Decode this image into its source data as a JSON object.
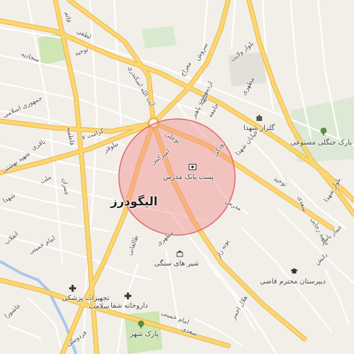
{
  "map": {
    "city_label": "الیگودرز",
    "colors": {
      "background": "#f2efe9",
      "primary_road": "#fcd670",
      "primary_road_casing": "#e8b84a",
      "minor_road": "#ffffff",
      "park": "#cde6b3",
      "water": "#a7c8e8",
      "highlight_circle_fill": "#f28b8b",
      "highlight_circle_stroke": "#e06666"
    },
    "highlight": {
      "label": "پست بانک مدرس",
      "icon": "bank-icon"
    },
    "pois": [
      {
        "label": "گلزار شهدا",
        "icon": "cemetery-icon"
      },
      {
        "label": "پارک جنگلی مصنوعی",
        "icon": "tree-icon"
      },
      {
        "label": "شیر های سنگی",
        "icon": "monument-icon"
      },
      {
        "label": "دبیرستان محترم قاضی",
        "icon": "school-icon"
      },
      {
        "label": "تجهیزات پزشکی سلامت",
        "icon": "pharmacy-icon"
      },
      {
        "label": "داروخانه شفا",
        "icon": "pharmacy-icon"
      },
      {
        "label": "پارک شهر",
        "icon": "tree-icon"
      }
    ],
    "streets": [
      "لطفی",
      "توحید",
      "سجادیه",
      "قائم",
      "جمهوری اسلامی",
      "کرامت ۷",
      "آیت الله اسکندری",
      "امیرکبیر",
      "نیلوفر",
      "فاطمیه",
      "باقری",
      "ملت",
      "شهید بهشتی",
      "چمران",
      "شهدا",
      "امام خمینی",
      "فردوسی",
      "طالقانی",
      "مطهری",
      "بوعلی",
      "مدرس",
      "شهید باهنر",
      "اردیبهشت",
      "رودکی",
      "سروش",
      "معراج",
      "بلوار ولایت",
      "جامعه",
      "توحید",
      "خیابان شهدا",
      "دانش",
      "سعدی",
      "شهید رجایی",
      "مطهری",
      "پونه زار",
      "هلال احمر",
      "امام خمینی",
      "سعدی",
      "بلوار شهدا",
      "عمار یاسر",
      "عاشورا",
      "انقلاب"
    ]
  }
}
